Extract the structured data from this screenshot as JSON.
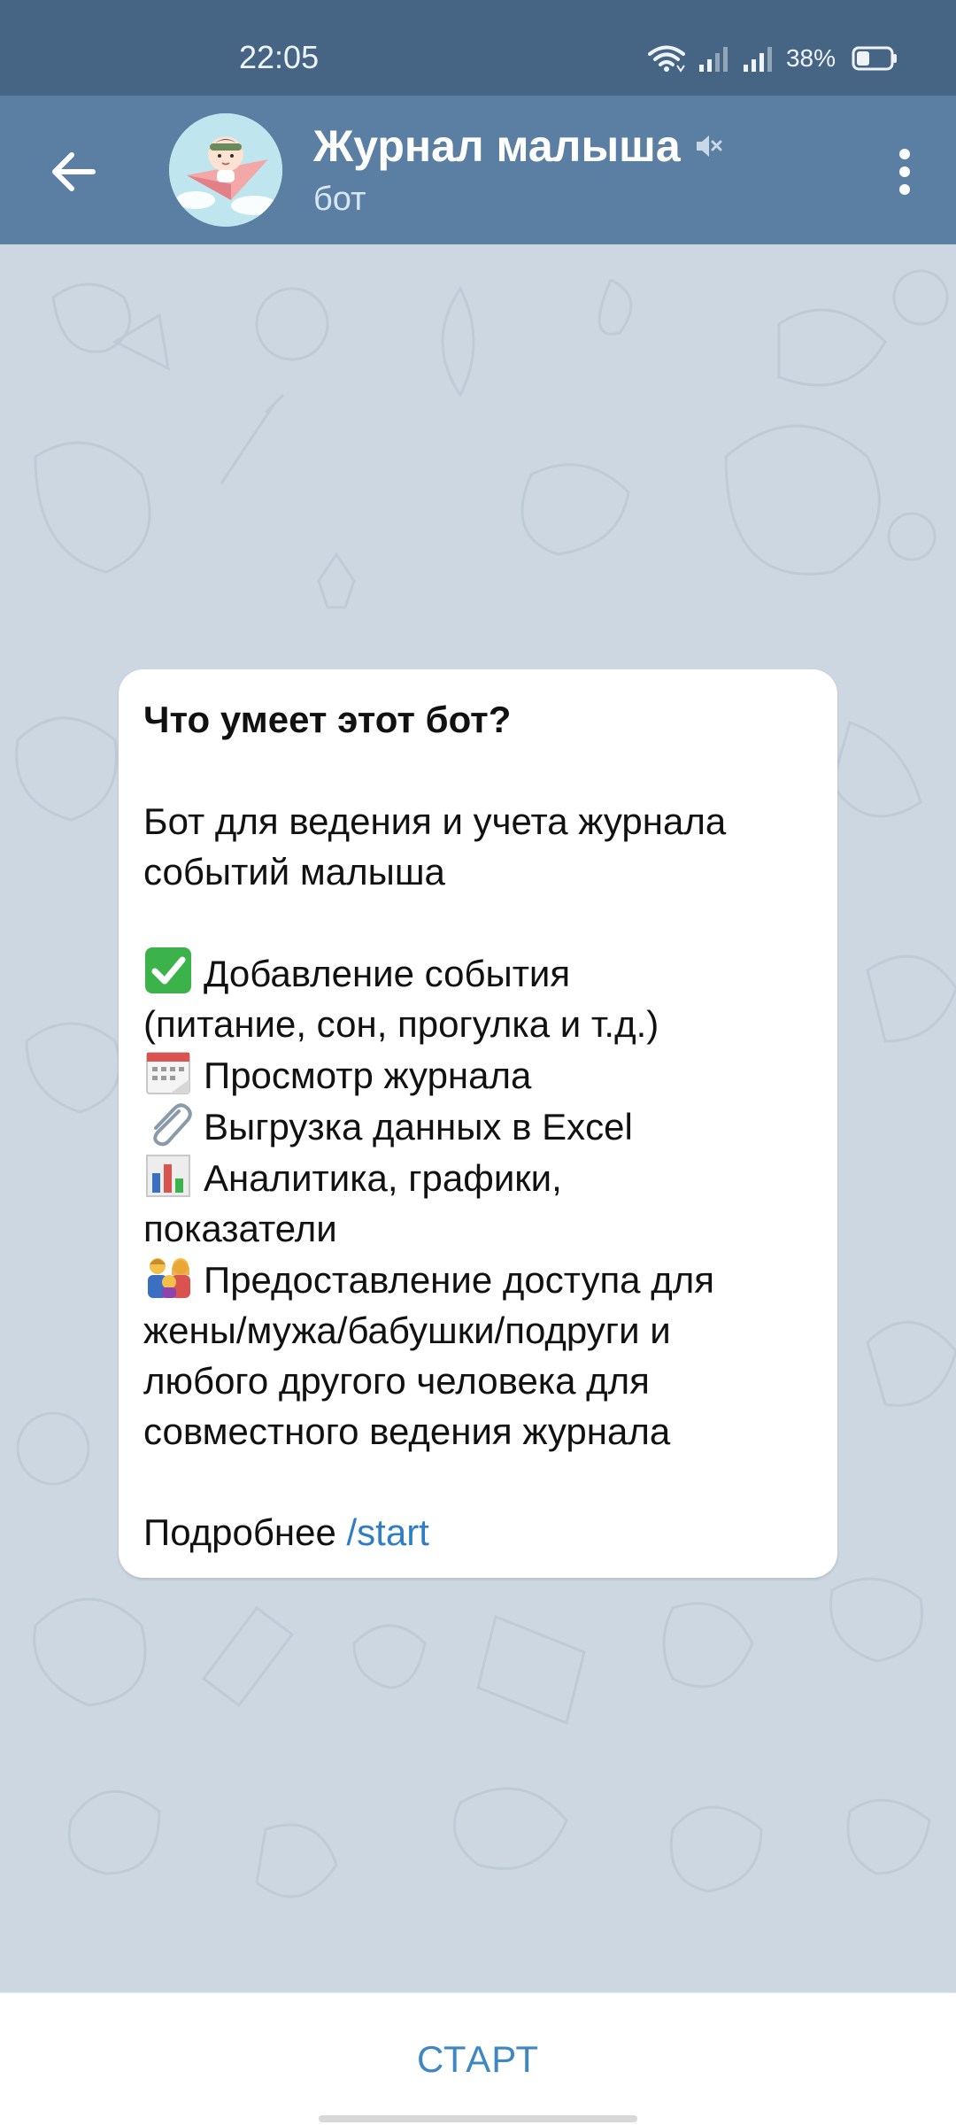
{
  "status_bar": {
    "time": "22:05",
    "battery_percent": "38%",
    "battery_level": 0.38,
    "icons": [
      "wifi-icon",
      "signal-icon",
      "signal-icon",
      "battery-icon"
    ]
  },
  "app_bar": {
    "title": "Журнал малыша",
    "subtitle": "бот",
    "back_icon": "arrow-left-icon",
    "muted_icon": "speaker-muted-icon",
    "menu_icon": "more-vertical-icon"
  },
  "card": {
    "heading": "Что умеет этот бот?",
    "intro_lines": [
      "Бот для ведения и учета журнала",
      "событий малыша"
    ],
    "feature_1": [
      "Добавление события",
      "(питание, сон, прогулка и т.д.)"
    ],
    "feature_2": "Просмотр журнала",
    "feature_3": "Выгрузка данных в Excel",
    "feature_4": [
      "Аналитика, графики,",
      "показатели"
    ],
    "feature_5": [
      "Предоставление доступа для",
      "жены/мужа/бабушки/подруги и",
      "любого другого человека для",
      "совместного ведения журнала"
    ],
    "more_label": "Подробнее",
    "more_link": "/start",
    "emoji_icons": [
      "check-mark-icon",
      "calendar-icon",
      "paperclip-icon",
      "bar-chart-icon",
      "family-icon"
    ]
  },
  "bottom": {
    "start_label": "СТАРТ"
  },
  "colors": {
    "status_bar": "#466584",
    "app_bar": "#5b7fa3",
    "chat_background": "#cdd7e1",
    "link": "#2e7ec7",
    "start_button": "#3e86c4"
  }
}
